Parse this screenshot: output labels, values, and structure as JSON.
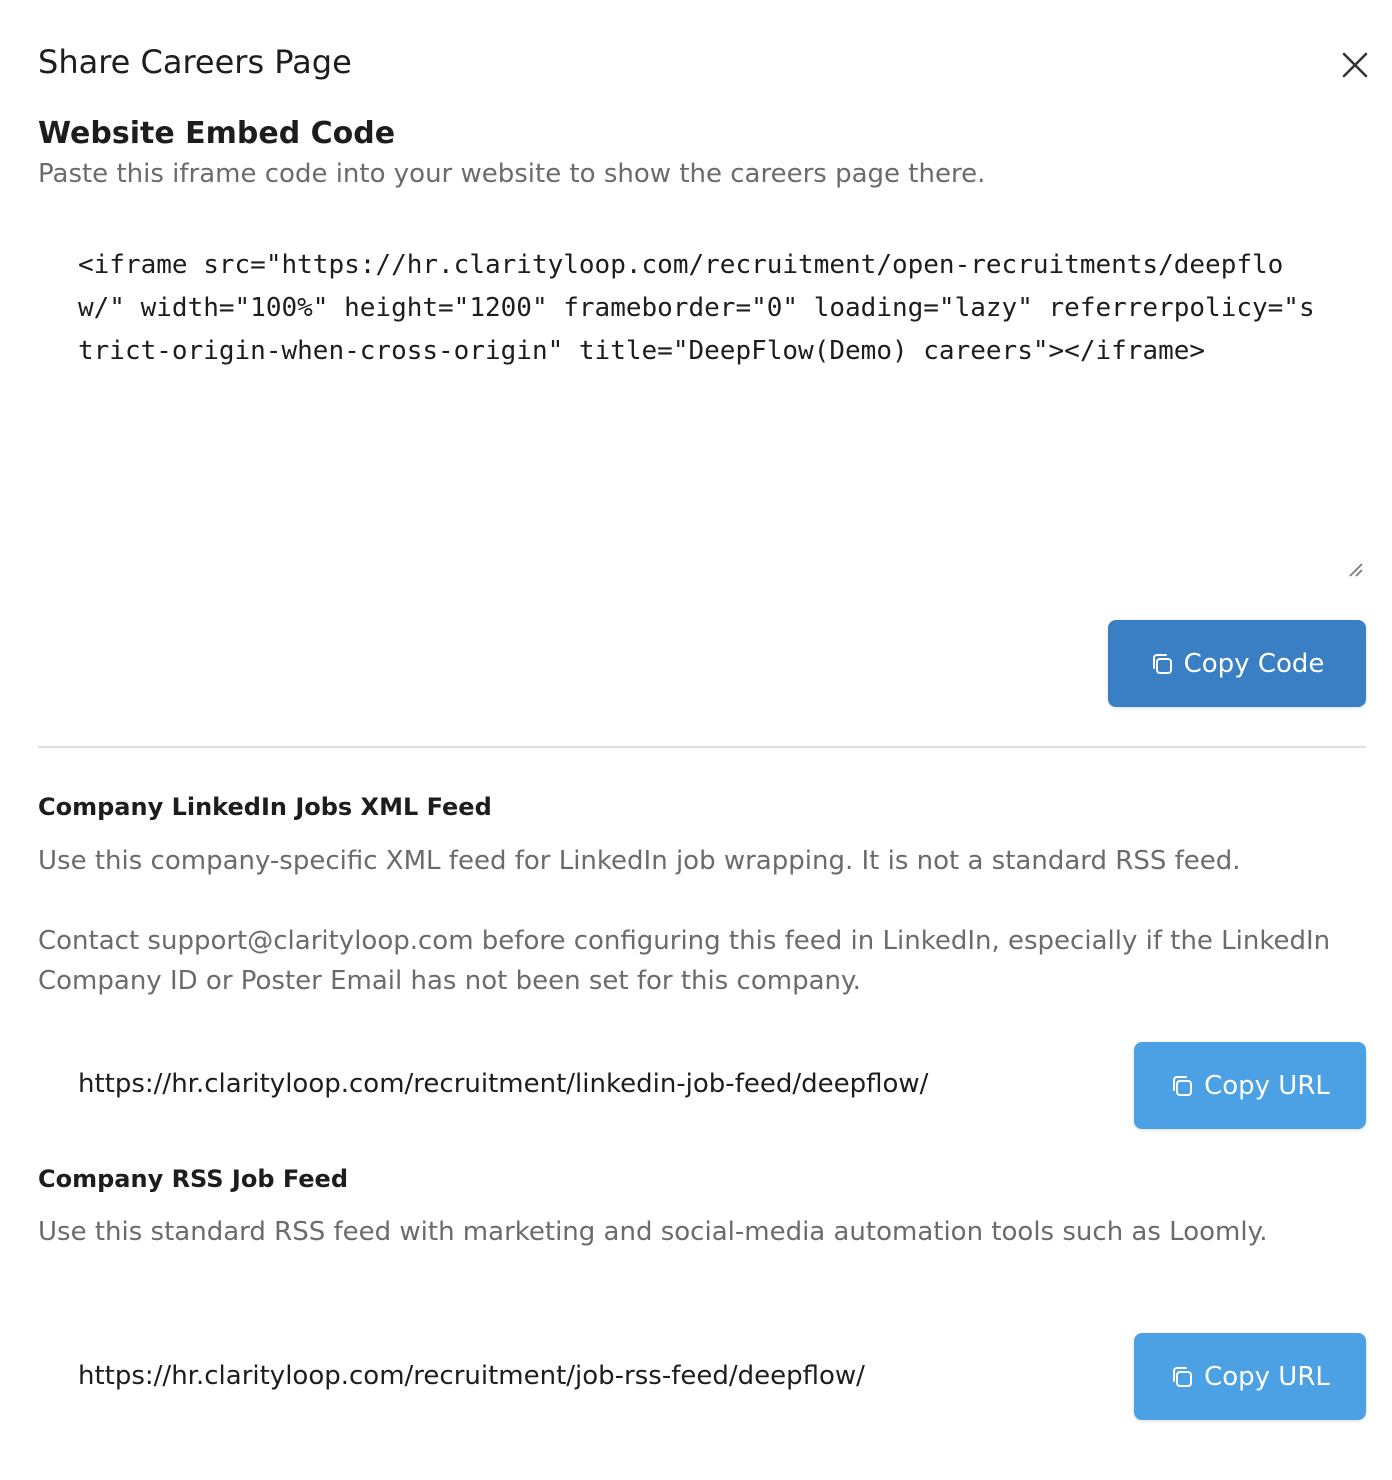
{
  "dialog": {
    "title": "Share Careers Page",
    "close_icon": "close-icon"
  },
  "embed": {
    "heading": "Website Embed Code",
    "description": "Paste this iframe code into your website to show the careers page there.",
    "code": "<iframe src=\"https://hr.clarityloop.com/recruitment/open-recruitments/deepflow/\" width=\"100%\" height=\"1200\" frameborder=\"0\" loading=\"lazy\" referrerpolicy=\"strict-origin-when-cross-origin\" title=\"DeepFlow(Demo) careers\"></iframe>",
    "copy_button_label": "Copy Code",
    "copy_icon": "copy-icon"
  },
  "linkedin_feed": {
    "heading": "Company LinkedIn Jobs XML Feed",
    "description_1": "Use this company-specific XML feed for LinkedIn job wrapping. It is not a standard RSS feed.",
    "description_2": "Contact support@clarityloop.com before configuring this feed in LinkedIn, especially if the LinkedIn Company ID or Poster Email has not been set for this company.",
    "url": "https://hr.clarityloop.com/recruitment/linkedin-job-feed/deepflow/",
    "copy_button_label": "Copy URL"
  },
  "rss_feed": {
    "heading": "Company RSS Job Feed",
    "description": "Use this standard RSS feed with marketing and social-media automation tools such as Loomly.",
    "url": "https://hr.clarityloop.com/recruitment/job-rss-feed/deepflow/",
    "copy_button_label": "Copy URL"
  },
  "colors": {
    "copy_code_button": "#3a7fc4",
    "copy_url_button": "#4ca0e4",
    "muted_text": "#6b6b6b",
    "divider": "#e0e0e0"
  }
}
